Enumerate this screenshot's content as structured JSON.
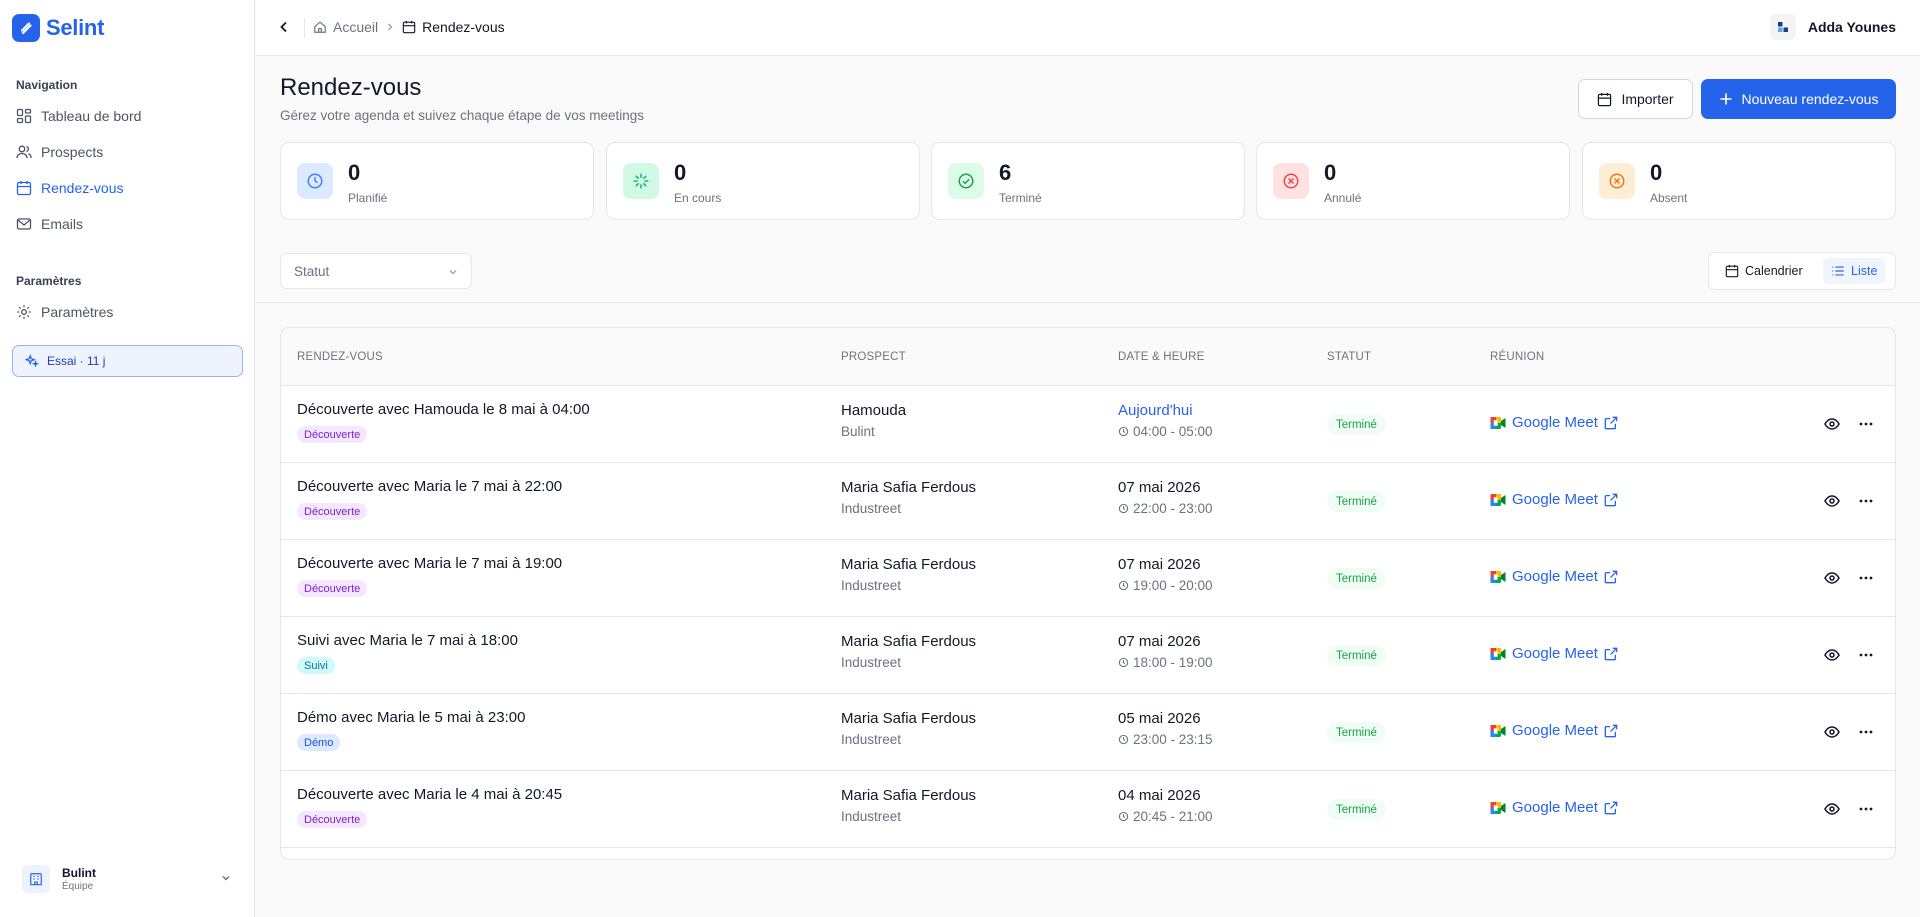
{
  "app": {
    "name": "Selint",
    "brand_color": "#2563eb"
  },
  "sidebar": {
    "nav_section": "Navigation",
    "items": [
      {
        "label": "Tableau de bord",
        "icon": "dashboard-icon"
      },
      {
        "label": "Prospects",
        "icon": "users-icon"
      },
      {
        "label": "Rendez-vous",
        "icon": "calendar-icon",
        "active": true
      },
      {
        "label": "Emails",
        "icon": "mail-icon"
      }
    ],
    "settings_section": "Paramètres",
    "settings_item": {
      "label": "Paramètres",
      "icon": "gear-icon"
    },
    "trial": "Essai · 11 j",
    "team": {
      "name": "Bulint",
      "role": "Équipe"
    }
  },
  "topbar": {
    "breadcrumb": [
      "Accueil",
      "Rendez-vous"
    ],
    "user": "Adda Younes"
  },
  "header": {
    "title": "Rendez-vous",
    "subtitle": "Gérez votre agenda et suivez chaque étape de vos meetings",
    "import_label": "Importer",
    "new_label": "Nouveau rendez-vous"
  },
  "stats": [
    {
      "value": "0",
      "label": "Planifié",
      "icon": "clock-icon",
      "color": "#3b82f6",
      "bg": "#dbeafe"
    },
    {
      "value": "0",
      "label": "En cours",
      "icon": "loader-icon",
      "color": "#10b981",
      "bg": "#d1fae5"
    },
    {
      "value": "6",
      "label": "Terminé",
      "icon": "check-circle-icon",
      "color": "#16a34a",
      "bg": "#dcfce7"
    },
    {
      "value": "0",
      "label": "Annulé",
      "icon": "x-circle-icon",
      "color": "#ef4444",
      "bg": "#fee2e2"
    },
    {
      "value": "0",
      "label": "Absent",
      "icon": "x-circle-icon",
      "color": "#f97316",
      "bg": "#ffedd5"
    }
  ],
  "filters": {
    "status_placeholder": "Statut",
    "view_calendar": "Calendrier",
    "view_list": "Liste"
  },
  "table": {
    "headers": [
      "RENDEZ-VOUS",
      "PROSPECT",
      "DATE & HEURE",
      "STATUT",
      "RÉUNION"
    ],
    "rows": [
      {
        "title": "Découverte avec Hamouda le 8 mai à 04:00",
        "tag": "Découverte",
        "tag_type": "decouverte",
        "prospect": "Hamouda",
        "company": "Bulint",
        "date": "Aujourd'hui",
        "today": true,
        "time": "04:00 - 05:00",
        "status": "Terminé",
        "meeting": "Google Meet"
      },
      {
        "title": "Découverte avec Maria le 7 mai à 22:00",
        "tag": "Découverte",
        "tag_type": "decouverte",
        "prospect": "Maria Safia Ferdous",
        "company": "Industreet",
        "date": "07 mai 2026",
        "time": "22:00 - 23:00",
        "status": "Terminé",
        "meeting": "Google Meet"
      },
      {
        "title": "Découverte avec Maria le 7 mai à 19:00",
        "tag": "Découverte",
        "tag_type": "decouverte",
        "prospect": "Maria Safia Ferdous",
        "company": "Industreet",
        "date": "07 mai 2026",
        "time": "19:00 - 20:00",
        "status": "Terminé",
        "meeting": "Google Meet"
      },
      {
        "title": "Suivi avec Maria le 7 mai à 18:00",
        "tag": "Suivi",
        "tag_type": "suivi",
        "prospect": "Maria Safia Ferdous",
        "company": "Industreet",
        "date": "07 mai 2026",
        "time": "18:00 - 19:00",
        "status": "Terminé",
        "meeting": "Google Meet"
      },
      {
        "title": "Démo avec Maria le 5 mai à 23:00",
        "tag": "Démo",
        "tag_type": "demo",
        "prospect": "Maria Safia Ferdous",
        "company": "Industreet",
        "date": "05 mai 2026",
        "time": "23:00 - 23:15",
        "status": "Terminé",
        "meeting": "Google Meet"
      },
      {
        "title": "Découverte avec Maria le 4 mai à 20:45",
        "tag": "Découverte",
        "tag_type": "decouverte",
        "prospect": "Maria Safia Ferdous",
        "company": "Industreet",
        "date": "04 mai 2026",
        "time": "20:45 - 21:00",
        "status": "Terminé",
        "meeting": "Google Meet"
      }
    ]
  }
}
